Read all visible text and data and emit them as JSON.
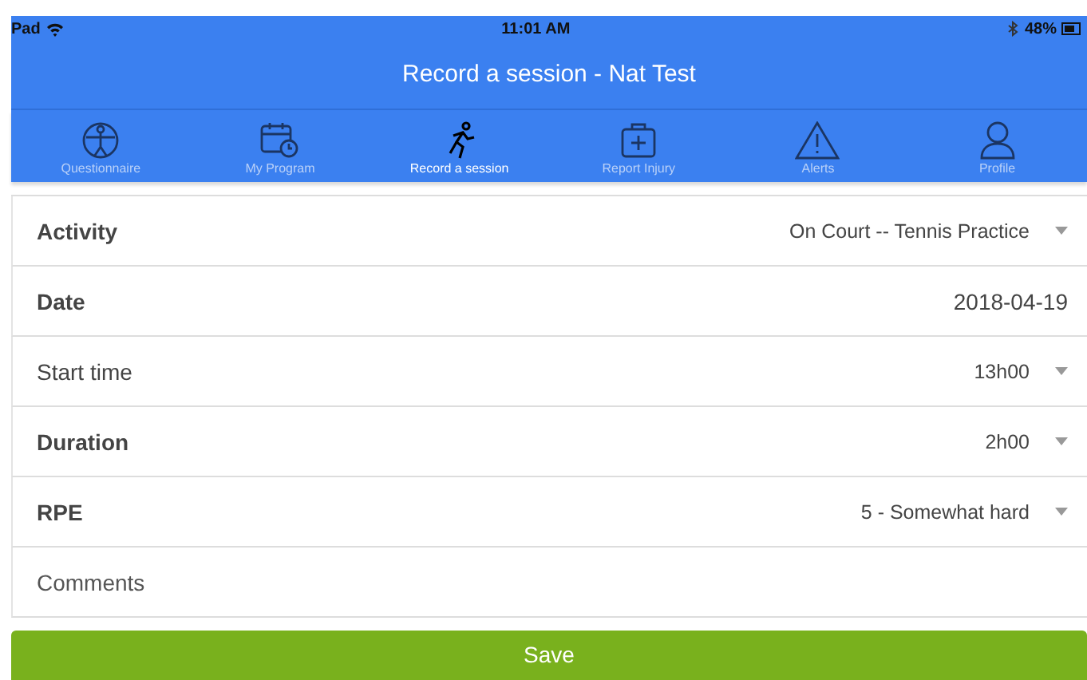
{
  "status_bar": {
    "carrier": "Pad",
    "time": "11:01 AM",
    "battery": "48%"
  },
  "title": "Record a session - Nat Test",
  "tabs": [
    {
      "label": "Questionnaire",
      "selected": false
    },
    {
      "label": "My Program",
      "selected": false
    },
    {
      "label": "Record a session",
      "selected": true
    },
    {
      "label": "Report Injury",
      "selected": false
    },
    {
      "label": "Alerts",
      "selected": false
    },
    {
      "label": "Profile",
      "selected": false
    }
  ],
  "form": [
    {
      "kind": "select",
      "label": "Activity",
      "required": true,
      "value": "On Court -- Tennis Practice"
    },
    {
      "kind": "date",
      "label": "Date",
      "required": true,
      "value": "2018-04-19"
    },
    {
      "kind": "select",
      "label": "Start time",
      "required": false,
      "value": "13h00"
    },
    {
      "kind": "select",
      "label": "Duration",
      "required": true,
      "value": "2h00"
    },
    {
      "kind": "select",
      "label": "RPE",
      "required": true,
      "value": "5 - Somewhat hard"
    },
    {
      "kind": "text",
      "placeholder": "Comments"
    }
  ],
  "save_button": "Save"
}
